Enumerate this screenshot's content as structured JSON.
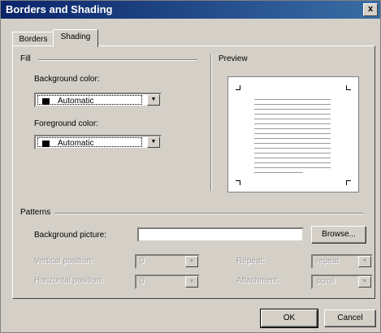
{
  "window": {
    "title": "Borders and Shading",
    "close_glyph": "x"
  },
  "tabs": [
    {
      "label": "Borders",
      "active": false
    },
    {
      "label": "Shading",
      "active": true
    }
  ],
  "fill": {
    "group_label": "Fill",
    "background_color": {
      "label": "Background color:",
      "value": "Automatic"
    },
    "foreground_color": {
      "label": "Foreground color:",
      "value": "Automatic"
    }
  },
  "preview": {
    "label": "Preview"
  },
  "patterns": {
    "group_label": "Patterns",
    "background_picture": {
      "label": "Background picture:",
      "value": ""
    },
    "browse_label": "Browse...",
    "vertical_position": {
      "label": "Vertical position:",
      "value": "0",
      "enabled": false
    },
    "horizontal_position": {
      "label": "Horizontal position:",
      "value": "0",
      "enabled": false
    },
    "repeat": {
      "label": "Repeat:",
      "value": "repeat",
      "enabled": false
    },
    "attachment": {
      "label": "Attachment:",
      "value": "scroll",
      "enabled": false
    }
  },
  "buttons": {
    "ok_label": "OK",
    "cancel_label": "Cancel"
  },
  "colors": {
    "title_bar": "#0a246a",
    "face": "#d4d0c8"
  }
}
